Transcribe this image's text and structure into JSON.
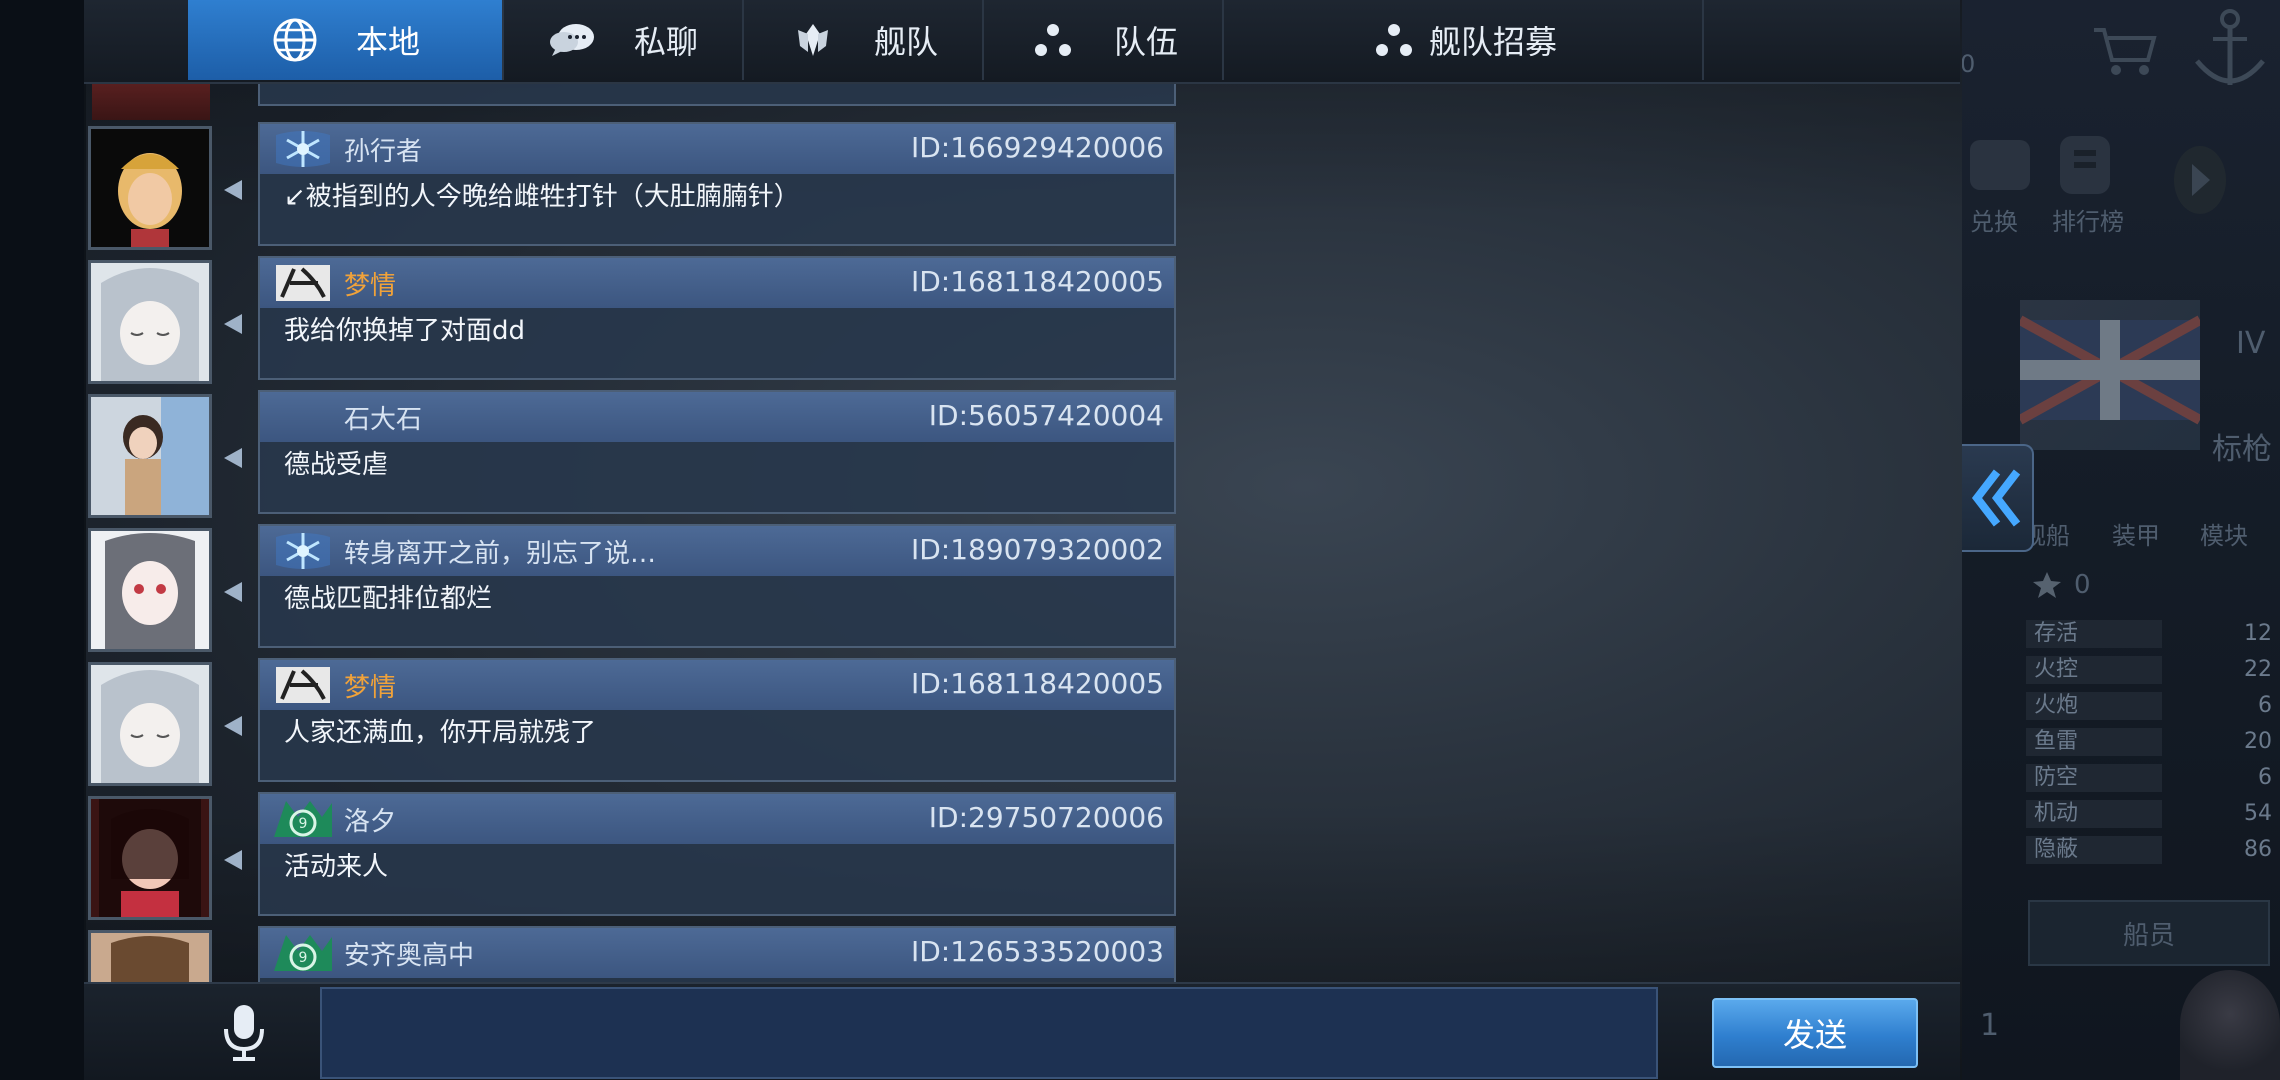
{
  "tabs": [
    {
      "label": "本地",
      "icon": "globe-icon",
      "active": true
    },
    {
      "label": "私聊",
      "icon": "chat-bubble-icon",
      "active": false
    },
    {
      "label": "舰队",
      "icon": "fleet-emblem-icon",
      "active": false
    },
    {
      "label": "队伍",
      "icon": "team-dots-icon",
      "active": false
    },
    {
      "label": "舰队招募",
      "icon": "team-dots-icon",
      "active": false
    }
  ],
  "messages": [
    {
      "name": "孙行者",
      "id": "ID:166929420006",
      "text": "↙被指到的人今晚给雌牲打针（大肚腩腩针）",
      "badge": "snowflake-badge-icon",
      "name_color": "default"
    },
    {
      "name": "梦情",
      "id": "ID:168118420005",
      "text": "我给你换掉了对面dd",
      "badge": "calligraphy-badge-icon",
      "name_color": "orange"
    },
    {
      "name": "石大石",
      "id": "ID:56057420004",
      "text": "德战受虐",
      "badge": "",
      "name_color": "default"
    },
    {
      "name": "转身离开之前，别忘了说…",
      "id": "ID:189079320002",
      "text": "德战匹配排位都烂",
      "badge": "snowflake-badge-icon",
      "name_color": "default"
    },
    {
      "name": "梦情",
      "id": "ID:168118420005",
      "text": "人家还满血，你开局就残了",
      "badge": "calligraphy-badge-icon",
      "name_color": "orange"
    },
    {
      "name": "洛夕",
      "id": "ID:29750720006",
      "text": "活动来人",
      "badge": "green-wing-badge-icon",
      "name_color": "default"
    },
    {
      "name": "安齐奥高中",
      "id": "ID:126533520003",
      "text": "",
      "badge": "green-wing-badge-icon",
      "name_color": "default"
    }
  ],
  "input": {
    "value": ""
  },
  "send_label": "发送",
  "right_panel": {
    "tier": "IV",
    "class_label": "标枪",
    "tabs": [
      "舰船",
      "装甲",
      "模块"
    ],
    "star_count": "0",
    "stats": [
      {
        "label": "存活",
        "value": "12"
      },
      {
        "label": "火控",
        "value": "22"
      },
      {
        "label": "火炮",
        "value": "6"
      },
      {
        "label": "鱼雷",
        "value": "20"
      },
      {
        "label": "防空",
        "value": "6"
      },
      {
        "label": "机动",
        "value": "54"
      },
      {
        "label": "隐蔽",
        "value": "86"
      }
    ],
    "crew_button": "船员",
    "exchange_label": "兑换",
    "leaderboard_label": "排行榜",
    "slot_number": "1",
    "top_counter": "0"
  }
}
